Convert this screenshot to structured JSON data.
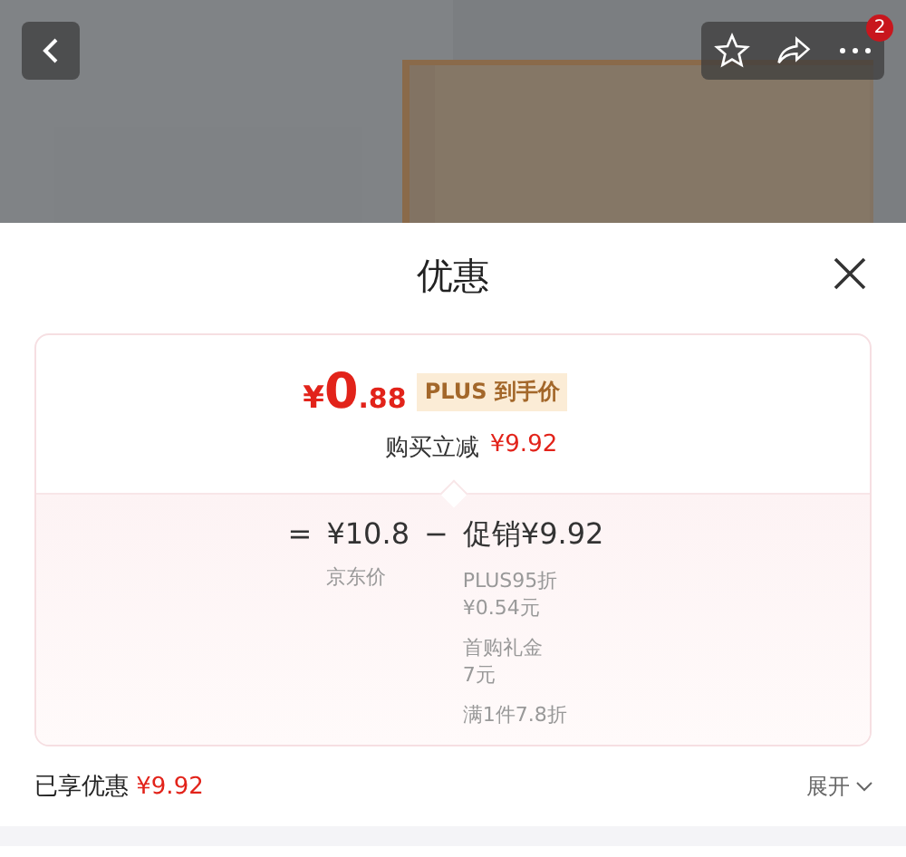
{
  "header": {
    "badge": "2"
  },
  "sheet": {
    "title": "优惠",
    "final_price": {
      "currency": "¥",
      "integer": "0",
      "decimal": ".88"
    },
    "price_tag": "PLUS 到手价",
    "saving_label": "购买立减",
    "saving_amount": "¥9.92",
    "formula": {
      "equals": "=",
      "base_price": "¥10.8",
      "base_label": "京东价",
      "minus": "−",
      "discount": "促销¥9.92",
      "discount_items": [
        {
          "name": "PLUS95折",
          "amount": "¥0.54元"
        },
        {
          "name": "首购礼金",
          "amount": "7元"
        },
        {
          "name": "满1件7.8折"
        }
      ]
    },
    "footer": {
      "label": "已享优惠",
      "amount": "¥9.92",
      "toggle": "展开"
    }
  }
}
